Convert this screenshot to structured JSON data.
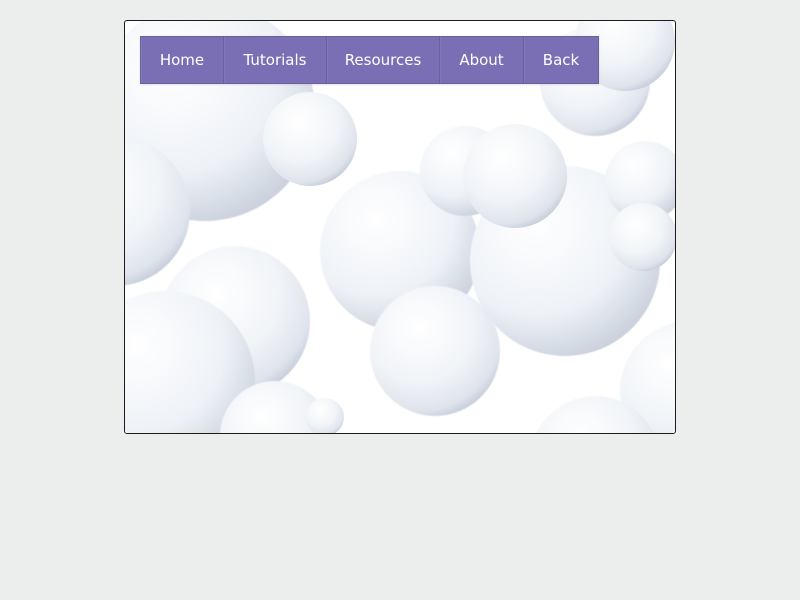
{
  "nav": {
    "items": [
      {
        "label": "Home"
      },
      {
        "label": "Tutorials"
      },
      {
        "label": "Resources"
      },
      {
        "label": "About"
      },
      {
        "label": "Back"
      }
    ]
  },
  "colors": {
    "page_background": "#eceeed",
    "nav_background": "#7a6fb5",
    "nav_text": "#ffffff",
    "frame_border": "#1c1c1c",
    "blob_fill": "#f3f6f9",
    "blob_shade": "#bcc4d2"
  }
}
